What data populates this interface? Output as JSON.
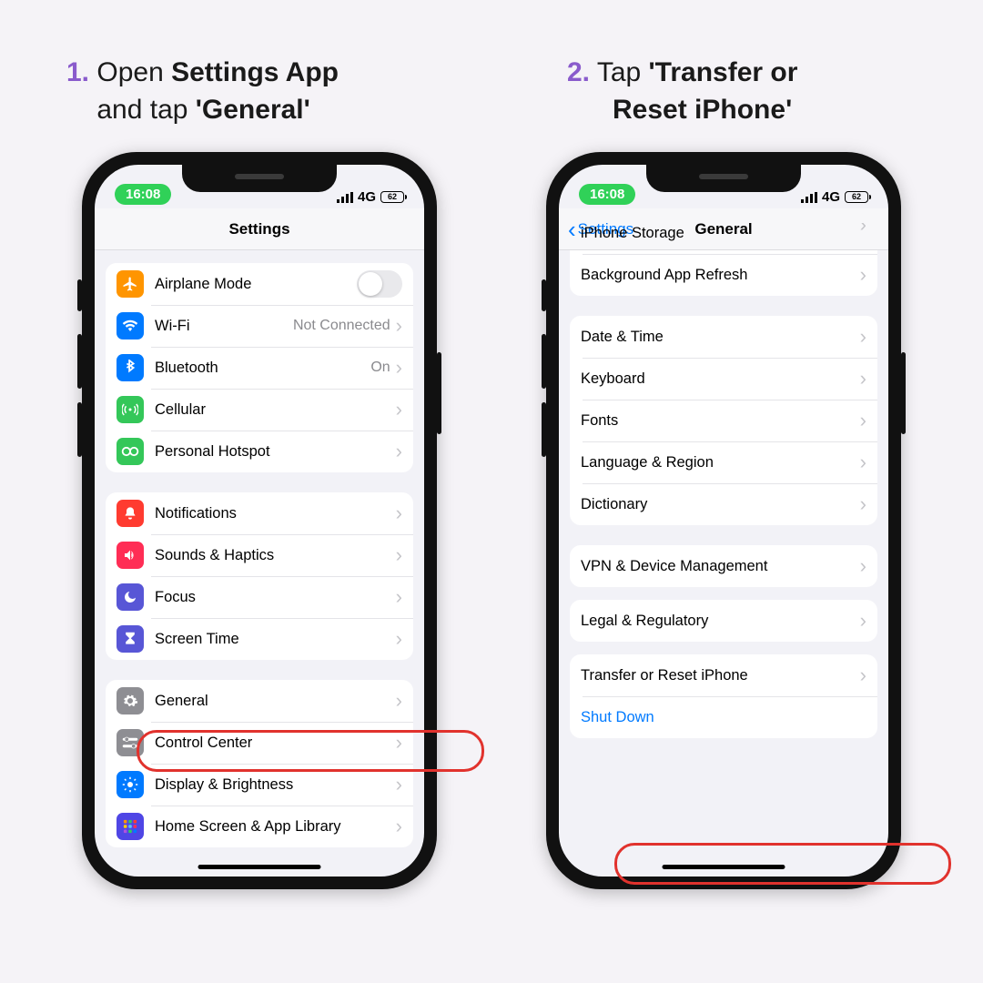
{
  "step1": {
    "num": "1.",
    "line1a": "Open ",
    "line1b": "Settings App",
    "line2a": "and tap ",
    "line2b": "'General'"
  },
  "step2": {
    "num": "2.",
    "line1a": "Tap  ",
    "line1b": "'Transfer or",
    "line2b": "Reset iPhone'"
  },
  "status": {
    "time": "16:08",
    "net": "4G",
    "batt": "62"
  },
  "nav1": {
    "title": "Settings"
  },
  "nav2": {
    "back": "Settings",
    "title": "General"
  },
  "s1": {
    "airplane": "Airplane Mode",
    "wifi": "Wi-Fi",
    "wifi_v": "Not Connected",
    "bt": "Bluetooth",
    "bt_v": "On",
    "cell": "Cellular",
    "hotspot": "Personal Hotspot",
    "notif": "Notifications",
    "sounds": "Sounds & Haptics",
    "focus": "Focus",
    "screentime": "Screen Time",
    "general": "General",
    "control": "Control Center",
    "display": "Display & Brightness",
    "home": "Home Screen & App Library"
  },
  "s2": {
    "storage": "iPhone Storage",
    "bgrefresh": "Background App Refresh",
    "date": "Date & Time",
    "keyboard": "Keyboard",
    "fonts": "Fonts",
    "lang": "Language & Region",
    "dict": "Dictionary",
    "vpn": "VPN & Device Management",
    "legal": "Legal & Regulatory",
    "transfer": "Transfer or Reset iPhone",
    "shutdown": "Shut Down"
  }
}
